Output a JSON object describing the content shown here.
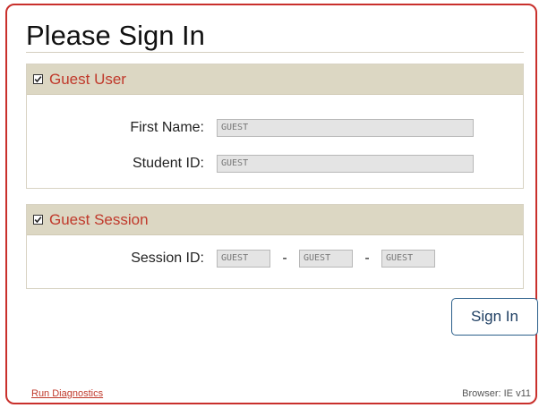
{
  "page": {
    "title": "Please Sign In"
  },
  "guest_user": {
    "header": "Guest User",
    "checked": true,
    "fields": {
      "first_name": {
        "label": "First Name:",
        "value": "GUEST"
      },
      "student_id": {
        "label": "Student ID:",
        "value": "GUEST"
      }
    }
  },
  "guest_session": {
    "header": "Guest Session",
    "checked": true,
    "session_id": {
      "label": "Session ID:",
      "part1": "GUEST",
      "part2": "GUEST",
      "part3": "GUEST",
      "separator": "-"
    }
  },
  "actions": {
    "sign_in_label": "Sign In"
  },
  "footer": {
    "diagnostics_link": "Run Diagnostics",
    "browser_info": "Browser: IE v11"
  },
  "colors": {
    "accent": "#c9302c",
    "section_header_bg": "#dcd7c3",
    "button_border": "#2b5f8a"
  },
  "icons": {
    "checkbox": "checkbox-checked-icon"
  }
}
